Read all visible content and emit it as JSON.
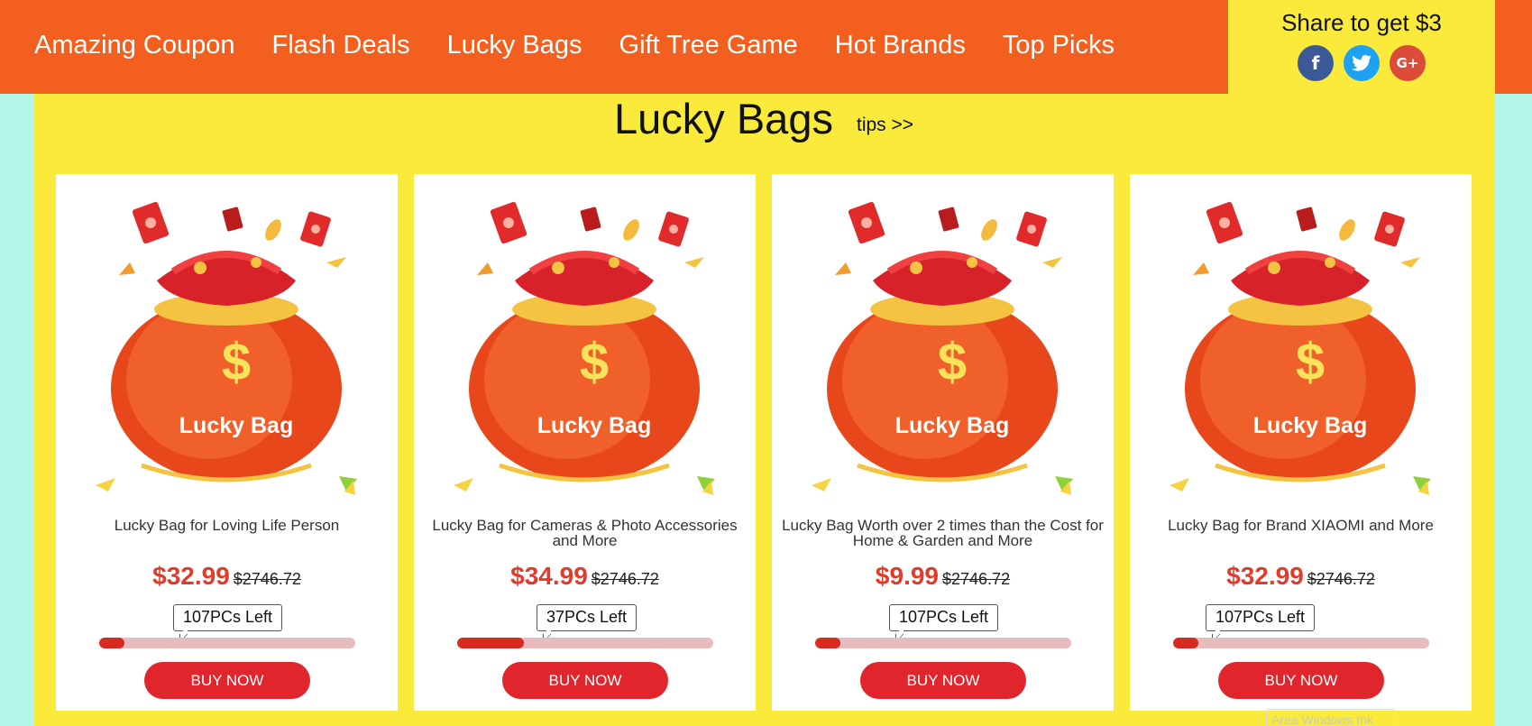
{
  "nav": {
    "items": [
      "Amazing Coupon",
      "Flash Deals",
      "Lucky Bags",
      "Gift Tree Game",
      "Hot Brands",
      "Top Picks"
    ]
  },
  "share": {
    "title": "Share to get $3",
    "icons": [
      {
        "name": "facebook-icon",
        "glyph": "f",
        "color": "#3b5998"
      },
      {
        "name": "twitter-icon",
        "glyph": "t",
        "color": "#1da1f2"
      },
      {
        "name": "google-plus-icon",
        "glyph": "G+",
        "color": "#dd4b39"
      }
    ]
  },
  "section": {
    "title": "Lucky Bags",
    "tips": "tips >>"
  },
  "products": [
    {
      "name": "Lucky Bag for Loving Life Person",
      "price": "$32.99",
      "old_price": "$2746.72",
      "stock": "107PCs Left",
      "progress": 0.1,
      "buy": "BUY NOW",
      "bag_label": "Lucky Bag",
      "bag_symbol": "$"
    },
    {
      "name": "Lucky Bag for Cameras & Photo Accessories and More",
      "price": "$34.99",
      "old_price": "$2746.72",
      "stock": "37PCs Left",
      "progress": 0.26,
      "buy": "BUY NOW",
      "bag_label": "Lucky Bag",
      "bag_symbol": "$"
    },
    {
      "name": "Lucky Bag Worth over 2 times than the Cost for Home & Garden and More",
      "price": "$9.99",
      "old_price": "$2746.72",
      "stock": "107PCs Left",
      "progress": 0.1,
      "buy": "BUY NOW",
      "bag_label": "Lucky Bag",
      "bag_symbol": "$"
    },
    {
      "name": "Lucky Bag for Brand XIAOMI and More",
      "price": "$32.99",
      "old_price": "$2746.72",
      "stock": "107PCs Left",
      "progress": 0.1,
      "buy": "BUY NOW",
      "bag_label": "Lucky Bag",
      "bag_symbol": "$"
    }
  ],
  "watermark": "Area Windows Ink",
  "colors": {
    "header": "#f25f1f",
    "panel": "#f9ea3c",
    "background": "#b3f7ea",
    "price": "#e23b2a",
    "button": "#e0262c"
  }
}
